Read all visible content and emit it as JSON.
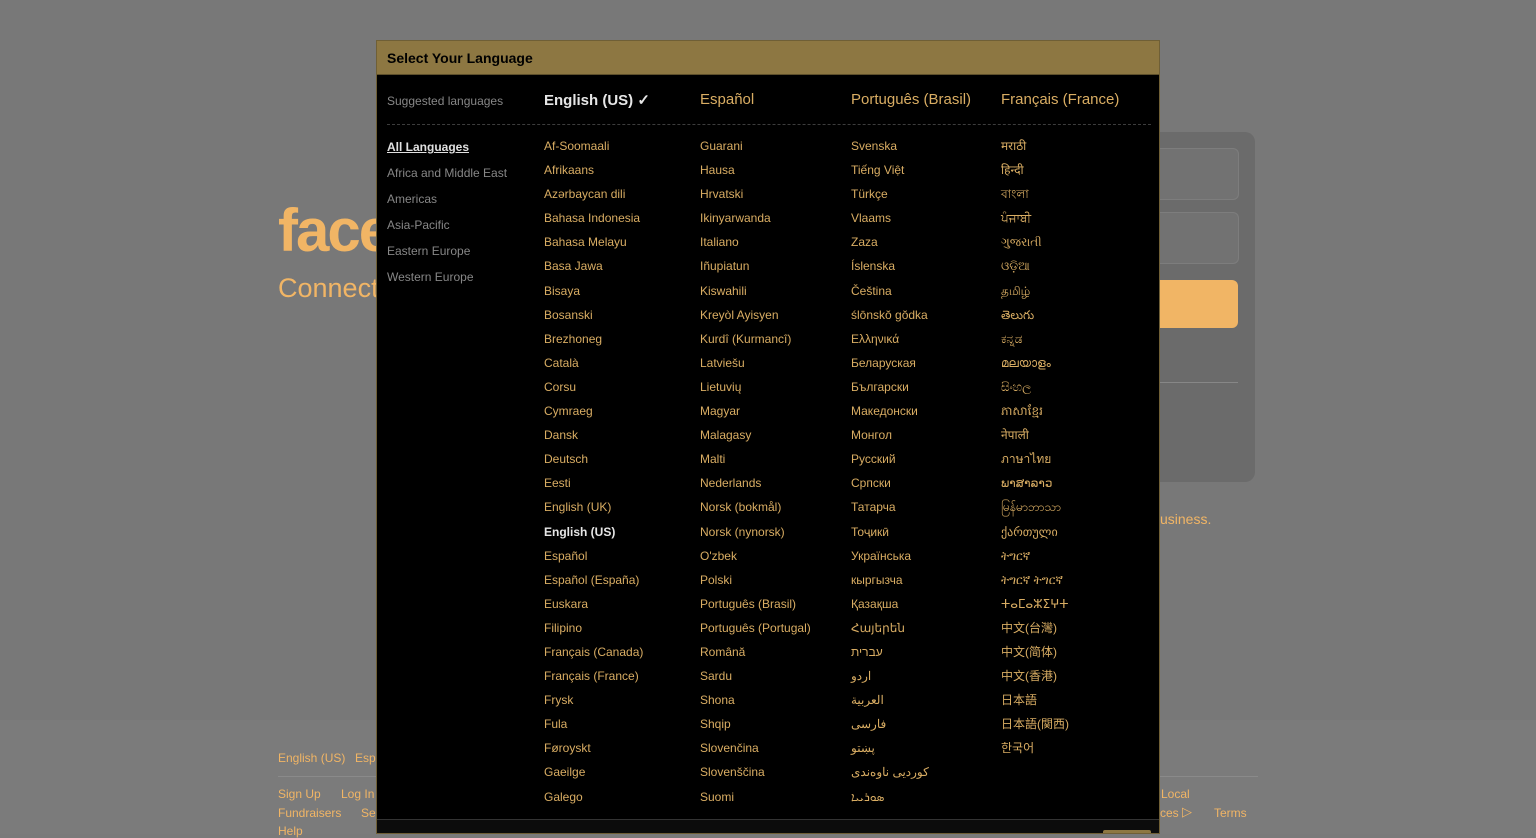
{
  "background": {
    "logo": "face",
    "tagline": "Connect with friends and the world around you",
    "business_text": "usiness.",
    "footer_languages": [
      "English (US)",
      "Esp"
    ],
    "footer_links_row1": [
      "Sign Up",
      "Log In"
    ],
    "footer_links_row1_right": "Local",
    "footer_links_row2": [
      "Fundraisers",
      "Se"
    ],
    "footer_links_row2_right": [
      "ces",
      "Terms"
    ],
    "footer_links_row3": [
      "Help"
    ]
  },
  "modal": {
    "title": "Select Your Language",
    "suggested_label": "Suggested languages",
    "suggested": [
      "English (US) ✓",
      "Español",
      "Português (Brasil)",
      "Français (France)"
    ],
    "regions": [
      "All Languages",
      "Africa and Middle East",
      "Americas",
      "Asia-Pacific",
      "Eastern Europe",
      "Western Europe"
    ],
    "columns": [
      [
        "Af-Soomaali",
        "Afrikaans",
        "Azərbaycan dili",
        "Bahasa Indonesia",
        "Bahasa Melayu",
        "Basa Jawa",
        "Bisaya",
        "Bosanski",
        "Brezhoneg",
        "Català",
        "Corsu",
        "Cymraeg",
        "Dansk",
        "Deutsch",
        "Eesti",
        "English (UK)",
        "English (US)",
        "Español",
        "Español (España)",
        "Euskara",
        "Filipino",
        "Français (Canada)",
        "Français (France)",
        "Frysk",
        "Fula",
        "Føroyskt",
        "Gaeilge",
        "Galego"
      ],
      [
        "Guarani",
        "Hausa",
        "Hrvatski",
        "Ikinyarwanda",
        "Italiano",
        "Iñupiatun",
        "Kiswahili",
        "Kreyòl Ayisyen",
        "Kurdî (Kurmancî)",
        "Latviešu",
        "Lietuvių",
        "Magyar",
        "Malagasy",
        "Malti",
        "Nederlands",
        "Norsk (bokmål)",
        "Norsk (nynorsk)",
        "O'zbek",
        "Polski",
        "Português (Brasil)",
        "Português (Portugal)",
        "Română",
        "Sardu",
        "Shona",
        "Shqip",
        "Slovenčina",
        "Slovenščina",
        "Suomi"
      ],
      [
        "Svenska",
        "Tiếng Việt",
        "Türkçe",
        "Vlaams",
        "Zaza",
        "Íslenska",
        "Čeština",
        "ślōnskŏ gŏdka",
        "Ελληνικά",
        "Беларуская",
        "Български",
        "Македонски",
        "Монгол",
        "Русский",
        "Српски",
        "Татарча",
        "Тоҷикӣ",
        "Українська",
        "кыргызча",
        "Қазақша",
        "Հայերեն",
        "עברית",
        "اردو",
        "العربية",
        "فارسی",
        "پښتو",
        "کوردیی ناوەندی",
        "ܣܘܪܝܝܐ"
      ],
      [
        "मराठी",
        "हिन्दी",
        "বাংলা",
        "ਪੰਜਾਬੀ",
        "ગુજરાતી",
        "ଓଡ଼ିଆ",
        "தமிழ்",
        "తెలుగు",
        "ಕನ್ನಡ",
        "മലയാളം",
        "සිංහල",
        "ភាសាខ្មែរ",
        "नेपाली",
        "ภาษาไทย",
        "ພາສາລາວ",
        "မြန်မာဘာသာ",
        "ქართული",
        "ትግርኛ",
        "ትግርኛ ትግርኛ",
        "ⵜⴰⵎⴰⵣⵉⵖⵜ",
        "中文(台灣)",
        "中文(简体)",
        "中文(香港)",
        "日本語",
        "日本語(関西)",
        "한국어"
      ]
    ],
    "current_language": "English (US)"
  }
}
